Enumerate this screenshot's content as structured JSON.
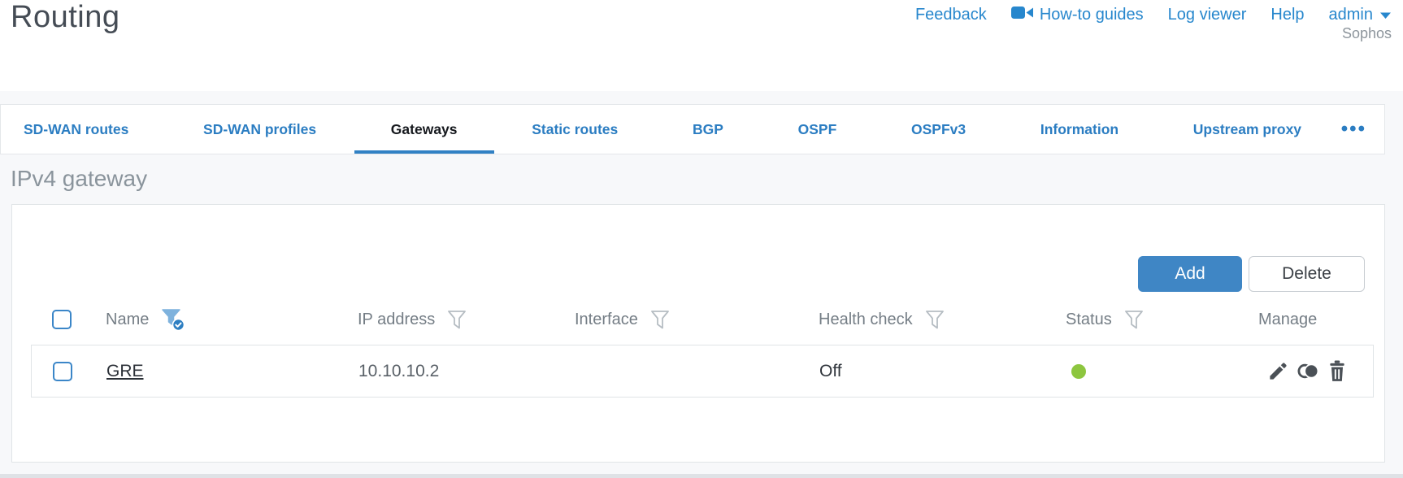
{
  "page": {
    "title": "Routing",
    "brand": "Sophos"
  },
  "top_nav": {
    "items": [
      {
        "label": "Feedback"
      },
      {
        "label": "How-to guides",
        "icon": "video-camera-icon"
      },
      {
        "label": "Log viewer"
      },
      {
        "label": "Help"
      },
      {
        "label": "admin",
        "icon": "caret-down-icon"
      }
    ]
  },
  "tabs": {
    "items": [
      {
        "label": "SD-WAN routes",
        "active": false
      },
      {
        "label": "SD-WAN profiles",
        "active": false
      },
      {
        "label": "Gateways",
        "active": true
      },
      {
        "label": "Static routes",
        "active": false
      },
      {
        "label": "BGP",
        "active": false
      },
      {
        "label": "OSPF",
        "active": false
      },
      {
        "label": "OSPFv3",
        "active": false
      },
      {
        "label": "Information",
        "active": false
      },
      {
        "label": "Upstream proxy",
        "active": false
      }
    ],
    "more_label": "•••"
  },
  "section": {
    "title": "IPv4 gateway"
  },
  "toolbar": {
    "add_label": "Add",
    "delete_label": "Delete"
  },
  "table": {
    "columns": [
      {
        "label": "Name",
        "filter": "active"
      },
      {
        "label": "IP address",
        "filter": "inactive"
      },
      {
        "label": "Interface",
        "filter": "inactive"
      },
      {
        "label": "Health check",
        "filter": "inactive"
      },
      {
        "label": "Status",
        "filter": "inactive"
      },
      {
        "label": "Manage",
        "filter": "none"
      }
    ],
    "rows": [
      {
        "name": "GRE",
        "ip_address": "10.10.10.2",
        "interface": "",
        "health_check": "Off",
        "status": "up",
        "actions": [
          "edit",
          "clone",
          "delete"
        ]
      }
    ]
  },
  "colors": {
    "accent_blue": "#3f86c5",
    "link_blue": "#2787cd",
    "tab_blue": "#2b7dc2",
    "status_up_green": "#8dc63f"
  }
}
